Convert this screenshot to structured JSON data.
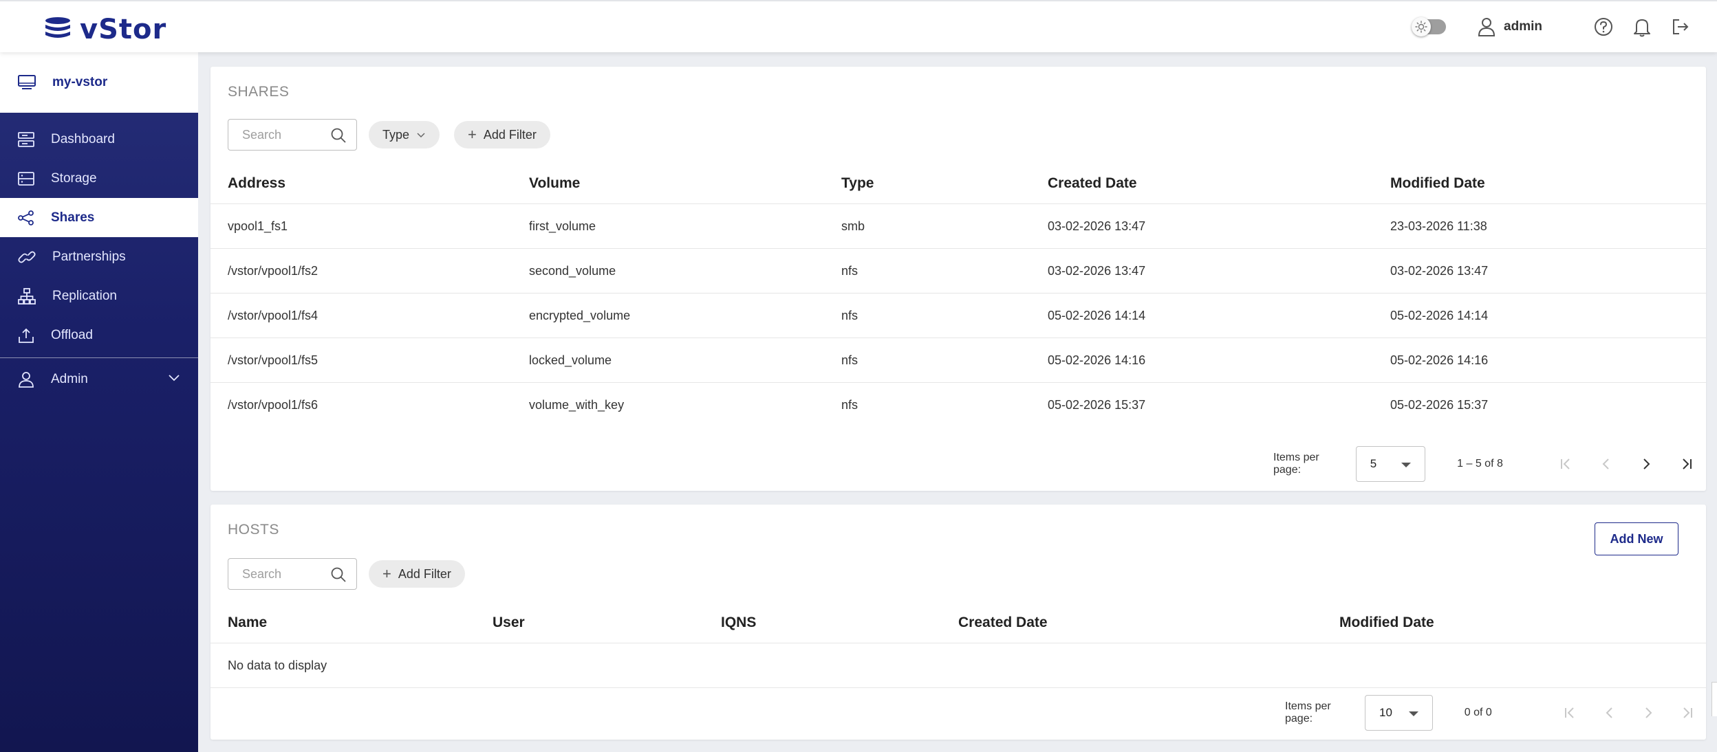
{
  "header": {
    "brand": "vStor",
    "username": "admin",
    "icons": [
      "theme-toggle",
      "user-icon",
      "help-icon",
      "bell-icon",
      "logout-icon"
    ]
  },
  "sidebar": {
    "device": "my-vstor",
    "items": [
      {
        "label": "Dashboard",
        "icon": "dashboard-icon"
      },
      {
        "label": "Storage",
        "icon": "storage-icon"
      },
      {
        "label": "Shares",
        "icon": "share-icon",
        "active": true
      },
      {
        "label": "Partnerships",
        "icon": "link-icon"
      },
      {
        "label": "Replication",
        "icon": "replication-icon"
      },
      {
        "label": "Offload",
        "icon": "upload-icon"
      }
    ],
    "admin": "Admin"
  },
  "shares": {
    "title": "SHARES",
    "search_placeholder": "Search",
    "type_chip": "Type",
    "add_filter": "Add Filter",
    "columns": [
      "Address",
      "Volume",
      "Type",
      "Created Date",
      "Modified Date"
    ],
    "rows": [
      [
        "vpool1_fs1",
        "first_volume",
        "smb",
        "03-02-2026 13:47",
        "23-03-2026 11:38"
      ],
      [
        "/vstor/vpool1/fs2",
        "second_volume",
        "nfs",
        "03-02-2026 13:47",
        "03-02-2026 13:47"
      ],
      [
        "/vstor/vpool1/fs4",
        "encrypted_volume",
        "nfs",
        "05-02-2026 14:14",
        "05-02-2026 14:14"
      ],
      [
        "/vstor/vpool1/fs5",
        "locked_volume",
        "nfs",
        "05-02-2026 14:16",
        "05-02-2026 14:16"
      ],
      [
        "/vstor/vpool1/fs6",
        "volume_with_key",
        "nfs",
        "05-02-2026 15:37",
        "05-02-2026 15:37"
      ]
    ],
    "pager": {
      "items_per_page_label": "Items per page:",
      "page_size": "5",
      "range": "1 – 5 of 8"
    }
  },
  "hosts": {
    "title": "HOSTS",
    "add_new": "Add New",
    "search_placeholder": "Search",
    "add_filter": "Add Filter",
    "columns": [
      "Name",
      "User",
      "IQNS",
      "Created Date",
      "Modified Date"
    ],
    "empty": "No data to display",
    "pager": {
      "items_per_page_label": "Items per page:",
      "page_size": "10",
      "range": "0 of 0"
    }
  },
  "colors": {
    "accent": "#1d2a8a",
    "sidebar_top": "#262e78",
    "sidebar_bottom": "#121650"
  }
}
